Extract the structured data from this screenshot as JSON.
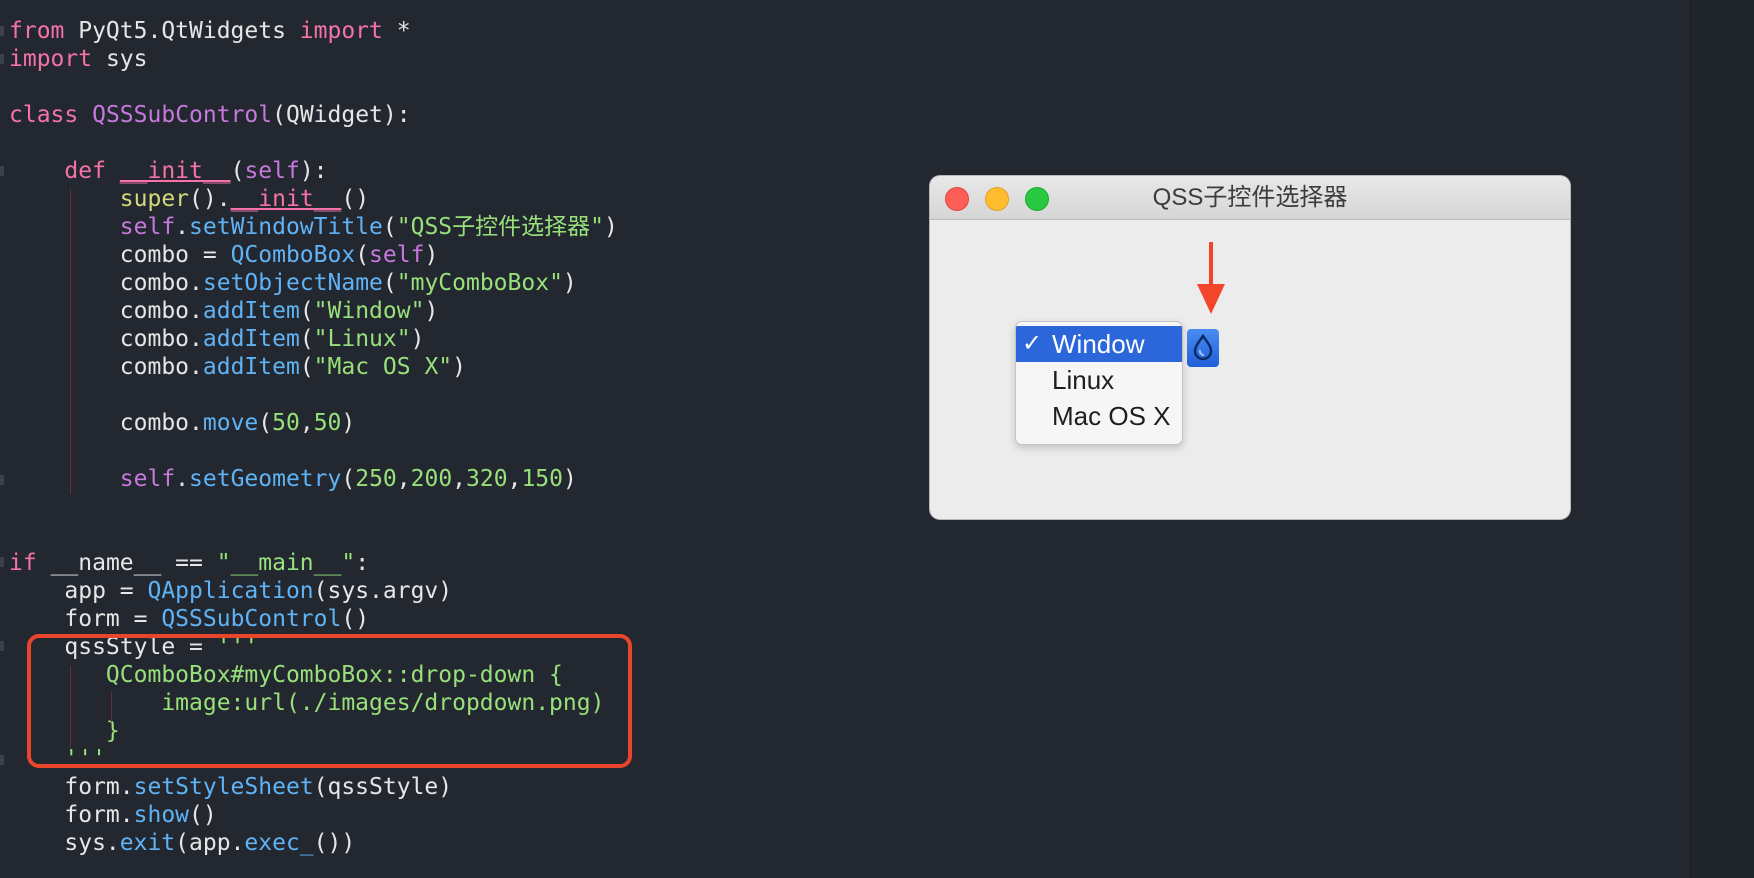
{
  "code_lines": [
    {
      "segments": [
        {
          "t": "from",
          "c": "kw"
        },
        {
          "t": " PyQt5.QtWidgets ",
          "c": "txt"
        },
        {
          "t": "import",
          "c": "kw"
        },
        {
          "t": " *",
          "c": "txt"
        }
      ]
    },
    {
      "segments": [
        {
          "t": "import",
          "c": "kw"
        },
        {
          "t": " sys",
          "c": "txt"
        }
      ]
    },
    {
      "segments": [
        {
          "t": "class",
          "c": "kw"
        },
        {
          "t": " ",
          "c": "txt"
        },
        {
          "t": "QSSSubControl",
          "c": "cls"
        },
        {
          "t": "(QWidget):",
          "c": "txt"
        }
      ]
    },
    {
      "segments": [
        {
          "t": "    ",
          "c": "txt"
        },
        {
          "t": "def",
          "c": "kw"
        },
        {
          "t": " ",
          "c": "txt"
        },
        {
          "t": "__init__",
          "c": "dund"
        },
        {
          "t": "(",
          "c": "txt"
        },
        {
          "t": "self",
          "c": "self"
        },
        {
          "t": "):",
          "c": "txt"
        }
      ]
    },
    {
      "segments": [
        {
          "t": "        ",
          "c": "txt"
        },
        {
          "t": "super",
          "c": "bi"
        },
        {
          "t": "().",
          "c": "txt"
        },
        {
          "t": "__init__",
          "c": "dund"
        },
        {
          "t": "()",
          "c": "txt"
        }
      ]
    },
    {
      "segments": [
        {
          "t": "        ",
          "c": "txt"
        },
        {
          "t": "self",
          "c": "self"
        },
        {
          "t": ".",
          "c": "txt"
        },
        {
          "t": "setWindowTitle",
          "c": "fn"
        },
        {
          "t": "(",
          "c": "txt"
        },
        {
          "t": "\"QSS子控件选择器\"",
          "c": "str"
        },
        {
          "t": ")",
          "c": "txt"
        }
      ]
    },
    {
      "segments": [
        {
          "t": "        combo = ",
          "c": "txt"
        },
        {
          "t": "QComboBox",
          "c": "fn"
        },
        {
          "t": "(",
          "c": "txt"
        },
        {
          "t": "self",
          "c": "self"
        },
        {
          "t": ")",
          "c": "txt"
        }
      ]
    },
    {
      "segments": [
        {
          "t": "        combo.",
          "c": "txt"
        },
        {
          "t": "setObjectName",
          "c": "fn"
        },
        {
          "t": "(",
          "c": "txt"
        },
        {
          "t": "\"myComboBox\"",
          "c": "str"
        },
        {
          "t": ")",
          "c": "txt"
        }
      ]
    },
    {
      "segments": [
        {
          "t": "        combo.",
          "c": "txt"
        },
        {
          "t": "addItem",
          "c": "fn"
        },
        {
          "t": "(",
          "c": "txt"
        },
        {
          "t": "\"Window\"",
          "c": "str"
        },
        {
          "t": ")",
          "c": "txt"
        }
      ]
    },
    {
      "segments": [
        {
          "t": "        combo.",
          "c": "txt"
        },
        {
          "t": "addItem",
          "c": "fn"
        },
        {
          "t": "(",
          "c": "txt"
        },
        {
          "t": "\"Linux\"",
          "c": "str"
        },
        {
          "t": ")",
          "c": "txt"
        }
      ]
    },
    {
      "segments": [
        {
          "t": "        combo.",
          "c": "txt"
        },
        {
          "t": "addItem",
          "c": "fn"
        },
        {
          "t": "(",
          "c": "txt"
        },
        {
          "t": "\"Mac OS X\"",
          "c": "str"
        },
        {
          "t": ")",
          "c": "txt"
        }
      ]
    },
    {
      "segments": [
        {
          "t": "        combo.",
          "c": "txt"
        },
        {
          "t": "move",
          "c": "fn"
        },
        {
          "t": "(",
          "c": "txt"
        },
        {
          "t": "50",
          "c": "num"
        },
        {
          "t": ",",
          "c": "txt"
        },
        {
          "t": "50",
          "c": "num"
        },
        {
          "t": ")",
          "c": "txt"
        }
      ]
    },
    {
      "segments": [
        {
          "t": "        ",
          "c": "txt"
        },
        {
          "t": "self",
          "c": "self"
        },
        {
          "t": ".",
          "c": "txt"
        },
        {
          "t": "setGeometry",
          "c": "fn"
        },
        {
          "t": "(",
          "c": "txt"
        },
        {
          "t": "250",
          "c": "num"
        },
        {
          "t": ",",
          "c": "txt"
        },
        {
          "t": "200",
          "c": "num"
        },
        {
          "t": ",",
          "c": "txt"
        },
        {
          "t": "320",
          "c": "num"
        },
        {
          "t": ",",
          "c": "txt"
        },
        {
          "t": "150",
          "c": "num"
        },
        {
          "t": ")",
          "c": "txt"
        }
      ]
    },
    {
      "segments": [
        {
          "t": "if",
          "c": "kw"
        },
        {
          "t": " __name__ == ",
          "c": "txt"
        },
        {
          "t": "\"__main__\"",
          "c": "str"
        },
        {
          "t": ":",
          "c": "txt"
        }
      ]
    },
    {
      "segments": [
        {
          "t": "    app = ",
          "c": "txt"
        },
        {
          "t": "QApplication",
          "c": "fn"
        },
        {
          "t": "(sys.argv)",
          "c": "txt"
        }
      ]
    },
    {
      "segments": [
        {
          "t": "    form = ",
          "c": "txt"
        },
        {
          "t": "QSSSubControl",
          "c": "fn"
        },
        {
          "t": "()",
          "c": "txt"
        }
      ]
    },
    {
      "segments": [
        {
          "t": "    qssStyle = ",
          "c": "txt"
        },
        {
          "t": "'''",
          "c": "str"
        }
      ]
    },
    {
      "segments": [
        {
          "t": "       QComboBox#myComboBox::drop-down {",
          "c": "str"
        }
      ]
    },
    {
      "segments": [
        {
          "t": "           image:url(./images/dropdown.png)",
          "c": "str"
        }
      ]
    },
    {
      "segments": [
        {
          "t": "       }",
          "c": "str"
        }
      ]
    },
    {
      "segments": [
        {
          "t": "    '''",
          "c": "str"
        }
      ]
    },
    {
      "segments": [
        {
          "t": "    form.",
          "c": "txt"
        },
        {
          "t": "setStyleSheet",
          "c": "fn"
        },
        {
          "t": "(qssStyle)",
          "c": "txt"
        }
      ]
    },
    {
      "segments": [
        {
          "t": "    form.",
          "c": "txt"
        },
        {
          "t": "show",
          "c": "fn"
        },
        {
          "t": "()",
          "c": "txt"
        }
      ]
    },
    {
      "segments": [
        {
          "t": "    sys.",
          "c": "txt"
        },
        {
          "t": "exit",
          "c": "fn"
        },
        {
          "t": "(app.",
          "c": "txt"
        },
        {
          "t": "exec_",
          "c": "fn"
        },
        {
          "t": "())",
          "c": "txt"
        }
      ]
    }
  ],
  "window": {
    "title": "QSS子控件选择器",
    "combo_items": [
      "Window",
      "Linux",
      "Mac OS X"
    ],
    "selected_index": 0,
    "check_glyph": "✓"
  },
  "colors": {
    "editor_bg": "#232830",
    "highlight": "#e8452a",
    "selection": "#2c66db",
    "arrow": "#f2452a"
  }
}
